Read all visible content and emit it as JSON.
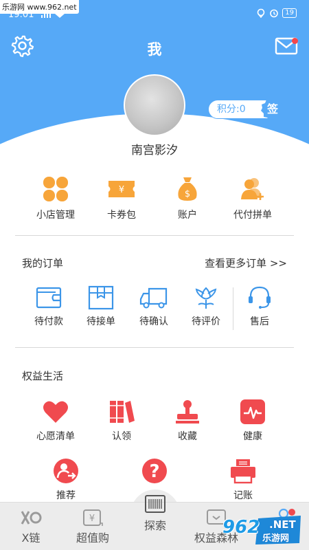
{
  "status_bar": {
    "watermark": "乐游网 www.962.net",
    "time": "19:01",
    "battery": "19"
  },
  "header": {
    "title": "我",
    "points_label": "积分:0",
    "sign_label": "签",
    "username": "南宫影汐"
  },
  "quick_actions": [
    {
      "label": "小店管理",
      "icon": "clover-icon"
    },
    {
      "label": "卡券包",
      "icon": "ticket-icon"
    },
    {
      "label": "账户",
      "icon": "money-bag-icon"
    },
    {
      "label": "代付拼单",
      "icon": "users-add-icon"
    }
  ],
  "orders": {
    "title": "我的订单",
    "more": "查看更多订单 >>",
    "items": [
      {
        "label": "待付款",
        "icon": "wallet-icon"
      },
      {
        "label": "待接单",
        "icon": "box-icon"
      },
      {
        "label": "待确认",
        "icon": "truck-icon"
      },
      {
        "label": "待评价",
        "icon": "flower-icon"
      },
      {
        "label": "售后",
        "icon": "headset-icon"
      }
    ]
  },
  "benefits": {
    "title": "权益生活",
    "items": [
      {
        "label": "心愿清单",
        "icon": "heart-icon"
      },
      {
        "label": "认领",
        "icon": "books-icon"
      },
      {
        "label": "收藏",
        "icon": "stamp-icon"
      },
      {
        "label": "健康",
        "icon": "pulse-icon"
      },
      {
        "label": "推荐",
        "icon": "recommend-icon"
      },
      {
        "label": "",
        "icon": "question-icon"
      },
      {
        "label": "记账",
        "icon": "printer-icon"
      }
    ]
  },
  "tabbar": {
    "tabs": [
      {
        "label": "X链",
        "icon": "x-chain-icon"
      },
      {
        "label": "超值购",
        "icon": "yen-tag-icon"
      },
      {
        "label": "探索",
        "icon": "barcode-icon"
      },
      {
        "label": "权益森林",
        "icon": "chat-box-icon"
      },
      {
        "label": "",
        "icon": "profile-icon"
      }
    ],
    "logo_text": "962",
    "logo_net": ".NET",
    "logo_cn": "乐游网"
  },
  "colors": {
    "primary": "#56a9f7",
    "orange": "#f7a53a",
    "order_blue": "#3b95e8",
    "red": "#f04a4f"
  }
}
